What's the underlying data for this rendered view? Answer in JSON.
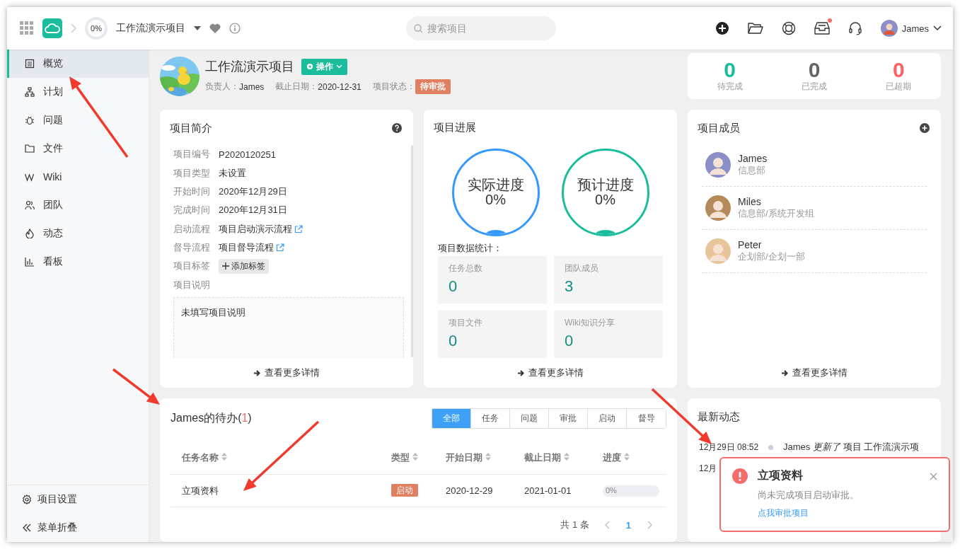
{
  "topbar": {
    "progress": "0%",
    "project": "工作流演示项目",
    "search": {
      "placeholder": "搜索项目"
    },
    "user": "James",
    "inbox_unread": true
  },
  "sidebar": {
    "items": [
      {
        "label": "概览",
        "selected": true,
        "kind": "overview"
      },
      {
        "label": "计划",
        "selected": false,
        "kind": "plan"
      },
      {
        "label": "问题",
        "selected": false,
        "kind": "issue"
      },
      {
        "label": "文件",
        "selected": false,
        "kind": "file"
      },
      {
        "label": "Wiki",
        "selected": false,
        "kind": "wiki"
      },
      {
        "label": "团队",
        "selected": false,
        "kind": "team"
      },
      {
        "label": "动态",
        "selected": false,
        "kind": "activity"
      },
      {
        "label": "看板",
        "selected": false,
        "kind": "board"
      }
    ],
    "footer": [
      {
        "label": "项目设置",
        "kind": "settings"
      },
      {
        "label": "菜单折叠",
        "kind": "collapse"
      }
    ]
  },
  "header": {
    "title": "工作流演示项目",
    "action": "操作",
    "owner_label": "负责人：",
    "owner": "James",
    "due_label": "截止日期：",
    "due": "2020-12-31",
    "status_label": "项目状态：",
    "status": "待审批"
  },
  "stats": [
    {
      "value": "0",
      "label": "待完成",
      "color": "#1abc9c"
    },
    {
      "value": "0",
      "label": "已完成",
      "color": "#666666"
    },
    {
      "value": "0",
      "label": "已超期",
      "color": "#ff6060"
    }
  ],
  "intro": {
    "title": "项目简介",
    "fields": [
      {
        "label": "项目编号",
        "value": "P2020120251",
        "kind": "text"
      },
      {
        "label": "项目类型",
        "value": "未设置",
        "kind": "text"
      },
      {
        "label": "开始时间",
        "value": "2020年12月29日",
        "kind": "text"
      },
      {
        "label": "完成时间",
        "value": "2020年12月31日",
        "kind": "text"
      },
      {
        "label": "启动流程",
        "value": "项目启动演示流程",
        "kind": "link"
      },
      {
        "label": "督导流程",
        "value": "项目督导流程",
        "kind": "link"
      },
      {
        "label": "项目标签",
        "value": "添加标签",
        "kind": "tag"
      }
    ],
    "description_label": "项目说明",
    "description": "未填写项目说明",
    "more": "查看更多详情"
  },
  "progress": {
    "title": "项目进展",
    "rings": [
      {
        "label": "实际进度",
        "value": "0%",
        "color": "#3399ff"
      },
      {
        "label": "预计进度",
        "value": "0%",
        "color": "#1abc9c"
      }
    ],
    "stats_title": "项目数据统计：",
    "stats": [
      {
        "label": "任务总数",
        "value": "0"
      },
      {
        "label": "团队成员",
        "value": "3"
      },
      {
        "label": "项目文件",
        "value": "0"
      },
      {
        "label": "Wiki知识分享",
        "value": "0"
      }
    ],
    "more": "查看更多详情"
  },
  "members": {
    "title": "项目成员",
    "list": [
      {
        "name": "James",
        "dept": "信息部",
        "color": "#8a8fc8"
      },
      {
        "name": "Miles",
        "dept": "信息部/系统开发组",
        "color": "#b58a5a"
      },
      {
        "name": "Peter",
        "dept": "企划部/企划一部",
        "color": "#e8c49a"
      }
    ],
    "more": "查看更多详情"
  },
  "todo": {
    "title": "James的待办(",
    "count": "1",
    "close": ")",
    "filters": [
      {
        "label": "全部",
        "selected": true
      },
      {
        "label": "任务",
        "selected": false
      },
      {
        "label": "问题",
        "selected": false
      },
      {
        "label": "审批",
        "selected": false
      },
      {
        "label": "启动",
        "selected": false
      },
      {
        "label": "督导",
        "selected": false
      }
    ],
    "columns": [
      "任务名称",
      "类型",
      "开始日期",
      "截止日期",
      "进度"
    ],
    "rows": [
      {
        "name": "立项资料",
        "type": "启动",
        "start": "2020-12-29",
        "due": "2021-01-01",
        "progress": "0%",
        "level": 0
      }
    ],
    "total": "共 1 条",
    "pages": [
      {
        "label": "1",
        "selected": true
      }
    ]
  },
  "activity": {
    "title": "最新动态",
    "items": [
      {
        "time": "12月29日 08:52",
        "text": "James *更新了* 项目 工作流演示项"
      },
      {
        "time": "12月"
      }
    ]
  },
  "notification": {
    "title": "立项资料",
    "message": "尚未完成项目启动审批。",
    "link": "点我审批项目"
  }
}
